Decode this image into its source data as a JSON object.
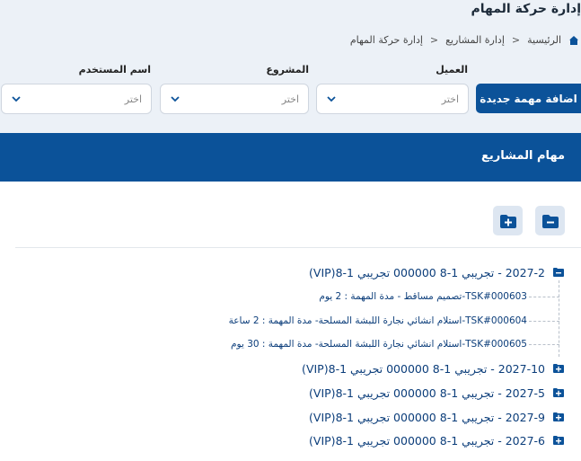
{
  "page_title": "إدارة حركة المهام",
  "breadcrumb": [
    "الرئيسية",
    "إدارة المشاريع",
    "إدارة حركة المهام"
  ],
  "filters": {
    "new_task_label": "اضافة مهمة جديدة",
    "client_label": "العميل",
    "project_label": "المشروع",
    "user_label": "اسم المستخدم",
    "placeholder": "اختر"
  },
  "section_title": "مهام المشاريع",
  "tree": {
    "expanded_node": "2027-2 - تجريبي 1-8 000000 تجريبي 1-8(VIP)",
    "leaves": [
      "TSK#000603-تصميم مساقط - مدة المهمة : 2 يوم",
      "TSK#000604-استلام انشائي نجارة اللبشة المسلحة- مدة المهمة : 2 ساعة",
      "TSK#000605-استلام انشائي نجارة اللبشة المسلحة- مدة المهمة : 30 يوم"
    ],
    "collapsed_nodes": [
      "2027-10 - تجريبي 1-8 000000 تجريبي 1-8(VIP)",
      "2027-5 - تجريبي 1-8 000000 تجريبي 1-8(VIP)",
      "2027-9 - تجريبي 1-8 000000 تجريبي 1-8(VIP)",
      "2027-6 - تجريبي 1-8 000000 تجريبي 1-8(VIP)"
    ]
  },
  "colors": {
    "primary": "#0b5299",
    "link": "#0b3d7a",
    "band": "#ecf1f7"
  },
  "icons": [
    "home-icon",
    "chevron-down-icon",
    "folder-minus-icon",
    "folder-plus-icon",
    "folder-open-icon",
    "folder-closed-icon"
  ]
}
